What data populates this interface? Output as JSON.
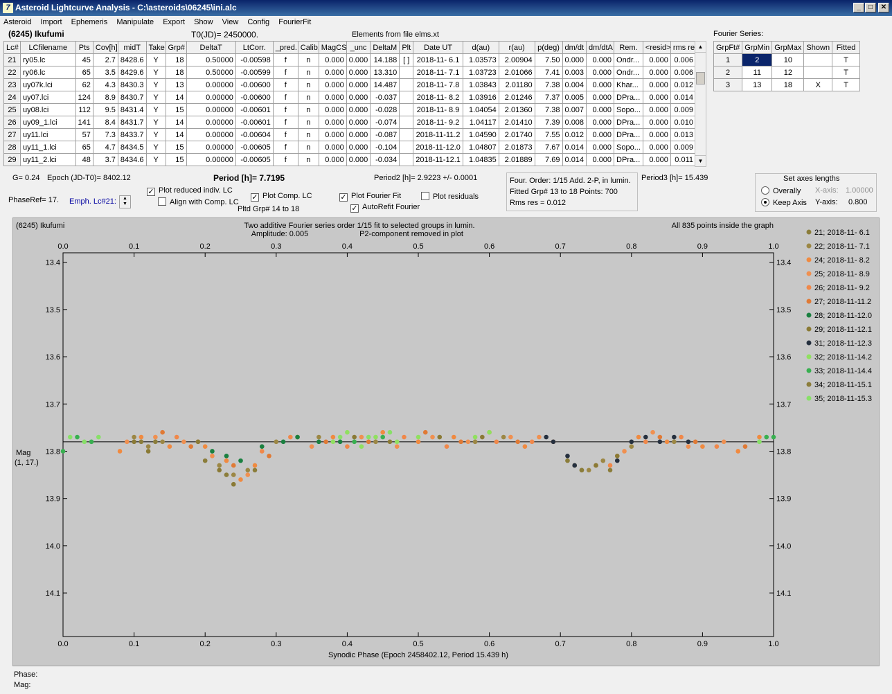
{
  "window": {
    "title": "Asteroid Lightcurve Analysis - C:\\asteroids\\06245\\ini.alc",
    "icon": "app-icon"
  },
  "menu": [
    "Asteroid",
    "Import",
    "Ephemeris",
    "Manipulate",
    "Export",
    "Show",
    "View",
    "Config",
    "FourierFit"
  ],
  "header": {
    "asteroid": "(6245) Ikufumi",
    "t0": "T0(JD)= 2450000.",
    "elements": "Elements from file elms.xt",
    "fourier_series_label": "Fourier Series:"
  },
  "lc_table": {
    "columns": [
      "Lc#",
      "LCfilename",
      "Pts",
      "Cov[h]",
      "midT",
      "Take",
      "Grp#",
      "DeltaT",
      "LtCorr.",
      "_pred.",
      "Calib.",
      "MagCS",
      "_unc",
      "DeltaM",
      "Plt",
      "Date UT",
      "d(au)",
      "r(au)",
      "p(deg)",
      "dm/dt",
      "dm/dtA",
      "Rem.",
      "<resid>",
      "rms res"
    ],
    "rows": [
      [
        "21",
        "ry05.lc",
        "45",
        "2.7",
        "8428.6",
        "Y",
        "18",
        "0.50000",
        "-0.00598",
        "f",
        "n",
        "0.000",
        "0.000",
        "14.188",
        "[ ]",
        "2018-11- 6.1",
        "1.03573",
        "2.00904",
        "7.50",
        "0.000",
        "0.000",
        "Ondr...",
        "0.000",
        "0.006"
      ],
      [
        "22",
        "ry06.lc",
        "65",
        "3.5",
        "8429.6",
        "Y",
        "18",
        "0.50000",
        "-0.00599",
        "f",
        "n",
        "0.000",
        "0.000",
        "13.310",
        "",
        "2018-11- 7.1",
        "1.03723",
        "2.01066",
        "7.41",
        "0.003",
        "0.000",
        "Ondr...",
        "0.000",
        "0.006"
      ],
      [
        "23",
        "uy07k.lci",
        "62",
        "4.3",
        "8430.3",
        "Y",
        "13",
        "0.00000",
        "-0.00600",
        "f",
        "n",
        "0.000",
        "0.000",
        "14.487",
        "",
        "2018-11- 7.8",
        "1.03843",
        "2.01180",
        "7.38",
        "0.004",
        "0.000",
        "Khar...",
        "0.000",
        "0.012"
      ],
      [
        "24",
        "uy07.lci",
        "124",
        "8.9",
        "8430.7",
        "Y",
        "14",
        "0.00000",
        "-0.00600",
        "f",
        "n",
        "0.000",
        "0.000",
        "-0.037",
        "",
        "2018-11- 8.2",
        "1.03916",
        "2.01246",
        "7.37",
        "0.005",
        "0.000",
        "DPra...",
        "0.000",
        "0.014"
      ],
      [
        "25",
        "uy08.lci",
        "112",
        "9.5",
        "8431.4",
        "Y",
        "15",
        "0.00000",
        "-0.00601",
        "f",
        "n",
        "0.000",
        "0.000",
        "-0.028",
        "",
        "2018-11- 8.9",
        "1.04054",
        "2.01360",
        "7.38",
        "0.007",
        "0.000",
        "Sopo...",
        "0.000",
        "0.009"
      ],
      [
        "26",
        "uy09_1.lci",
        "141",
        "8.4",
        "8431.7",
        "Y",
        "14",
        "0.00000",
        "-0.00601",
        "f",
        "n",
        "0.000",
        "0.000",
        "-0.074",
        "",
        "2018-11- 9.2",
        "1.04117",
        "2.01410",
        "7.39",
        "0.008",
        "0.000",
        "DPra...",
        "0.000",
        "0.010"
      ],
      [
        "27",
        "uy11.lci",
        "57",
        "7.3",
        "8433.7",
        "Y",
        "14",
        "0.00000",
        "-0.00604",
        "f",
        "n",
        "0.000",
        "0.000",
        "-0.087",
        "",
        "2018-11-11.2",
        "1.04590",
        "2.01740",
        "7.55",
        "0.012",
        "0.000",
        "DPra...",
        "0.000",
        "0.013"
      ],
      [
        "28",
        "uy11_1.lci",
        "65",
        "4.7",
        "8434.5",
        "Y",
        "15",
        "0.00000",
        "-0.00605",
        "f",
        "n",
        "0.000",
        "0.000",
        "-0.104",
        "",
        "2018-11-12.0",
        "1.04807",
        "2.01873",
        "7.67",
        "0.014",
        "0.000",
        "Sopo...",
        "0.000",
        "0.009"
      ],
      [
        "29",
        "uy11_2.lci",
        "48",
        "3.7",
        "8434.6",
        "Y",
        "15",
        "0.00000",
        "-0.00605",
        "f",
        "n",
        "0.000",
        "0.000",
        "-0.034",
        "",
        "2018-11-12.1",
        "1.04835",
        "2.01889",
        "7.69",
        "0.014",
        "0.000",
        "DPra...",
        "0.000",
        "0.011"
      ]
    ]
  },
  "fourier_table": {
    "columns": [
      "GrpFt#",
      "GrpMin",
      "GrpMax",
      "Shown",
      "Fitted"
    ],
    "rows": [
      [
        "1",
        "2",
        "10",
        "",
        "T"
      ],
      [
        "2",
        "11",
        "12",
        "",
        "T"
      ],
      [
        "3",
        "13",
        "18",
        "X",
        "T"
      ]
    ]
  },
  "controls": {
    "g": "G= 0.24",
    "epoch": "Epoch (JD-T0)= 8402.12",
    "period": "Period [h]= 7.7195",
    "period2": "Period2 [h]= 2.9223 +/- 0.0001",
    "phase_ref": "PhaseRef= 17.",
    "emph": "Emph. Lc#21:",
    "plot_reduced": "Plot reduced indiv. LC",
    "align_comp": "Align with Comp. LC",
    "plot_comp": "Plot Comp. LC",
    "pltd_grp": "Pltd Grp#  14 to   18",
    "plot_fourier": "Plot Fourier Fit",
    "autorefit": "AutoRefit Fourier",
    "plot_residuals": "Plot residuals",
    "plot_reduced_checked": true,
    "align_comp_checked": false,
    "plot_comp_checked": true,
    "plot_fourier_checked": true,
    "autorefit_checked": true,
    "plot_residuals_checked": false,
    "four_order": "Four. Order:  1/15    Add. 2-P, in lumin.",
    "fitted_grp": "Fitted Grp# 13 to 18 Points: 700",
    "rms_res": "Rms res     = 0.012",
    "period3": "Period3 [h]= 15.439",
    "axes": {
      "title": "Set axes lengths",
      "overally": "Overally",
      "keep_axis": "Keep Axis",
      "x_label": "X-axis:",
      "x_value": "1.00000",
      "y_label": "Y-axis:",
      "y_value": "0.800",
      "selected": "keep_axis"
    }
  },
  "footer": {
    "phase": "Phase:",
    "mag": "Mag:"
  },
  "chart_data": {
    "type": "scatter",
    "title": "Two additive Fourier series order 1/15 fit to selected groups in lumin.",
    "subtitle_left": "Amplitude: 0.005",
    "subtitle_right": "P2-component removed in plot",
    "top_left": "(6245) Ikufumi",
    "top_right": "All 835 points inside the graph",
    "xlabel": "Synodic Phase (Epoch 2458402.12, Period 15.439 h)",
    "ylabel": "Mag",
    "ylabel2": "(1, 17.)",
    "xlim": [
      0.0,
      1.0
    ],
    "ylim": [
      13.4,
      14.2
    ],
    "y_inverted": true,
    "xticks": [
      "0.0",
      "0.1",
      "0.2",
      "0.3",
      "0.4",
      "0.5",
      "0.6",
      "0.7",
      "0.8",
      "0.9",
      "1.0"
    ],
    "yticks": [
      "13.4",
      "13.5",
      "13.6",
      "13.7",
      "13.8",
      "13.9",
      "14.0",
      "14.1"
    ],
    "fit_level": 13.78,
    "series": [
      {
        "name": "21; 2018-11- 6.1",
        "color": "#8b7d3a",
        "points": []
      },
      {
        "name": "22; 2018-11- 7.1",
        "color": "#9c8744",
        "points": [
          [
            0.1,
            13.77
          ],
          [
            0.12,
            13.79
          ],
          [
            0.14,
            13.78
          ],
          [
            0.22,
            13.83
          ],
          [
            0.24,
            13.85
          ],
          [
            0.26,
            13.84
          ],
          [
            0.3,
            13.78
          ],
          [
            0.36,
            13.77
          ],
          [
            0.44,
            13.78
          ],
          [
            0.58,
            13.78
          ],
          [
            0.62,
            13.77
          ],
          [
            0.72,
            13.83
          ],
          [
            0.74,
            13.84
          ],
          [
            0.76,
            13.82
          ],
          [
            0.8,
            13.79
          ],
          [
            0.86,
            13.78
          ]
        ]
      },
      {
        "name": "24; 2018-11- 8.2",
        "color": "#f08a40",
        "points": [
          [
            0.08,
            13.8
          ],
          [
            0.11,
            13.77
          ],
          [
            0.15,
            13.79
          ],
          [
            0.2,
            13.79
          ],
          [
            0.23,
            13.82
          ],
          [
            0.25,
            13.86
          ],
          [
            0.27,
            13.83
          ],
          [
            0.33,
            13.77
          ],
          [
            0.38,
            13.77
          ],
          [
            0.45,
            13.76
          ],
          [
            0.5,
            13.78
          ],
          [
            0.55,
            13.77
          ],
          [
            0.6,
            13.76
          ],
          [
            0.65,
            13.79
          ],
          [
            0.69,
            13.78
          ],
          [
            0.78,
            13.81
          ],
          [
            0.81,
            13.77
          ],
          [
            0.85,
            13.78
          ],
          [
            0.9,
            13.79
          ],
          [
            0.95,
            13.8
          ],
          [
            0.98,
            13.77
          ]
        ]
      },
      {
        "name": "25; 2018-11- 8.9",
        "color": "#f09050",
        "points": [
          [
            0.09,
            13.78
          ],
          [
            0.13,
            13.77
          ],
          [
            0.17,
            13.78
          ],
          [
            0.21,
            13.81
          ],
          [
            0.26,
            13.85
          ],
          [
            0.35,
            13.79
          ],
          [
            0.42,
            13.77
          ],
          [
            0.47,
            13.79
          ],
          [
            0.52,
            13.77
          ],
          [
            0.57,
            13.78
          ],
          [
            0.63,
            13.77
          ],
          [
            0.67,
            13.77
          ],
          [
            0.79,
            13.8
          ],
          [
            0.83,
            13.76
          ],
          [
            0.88,
            13.79
          ],
          [
            0.93,
            13.78
          ]
        ]
      },
      {
        "name": "26; 2018-11- 9.2",
        "color": "#f0884a",
        "points": [
          [
            0.16,
            13.77
          ],
          [
            0.19,
            13.78
          ],
          [
            0.28,
            13.8
          ],
          [
            0.32,
            13.77
          ],
          [
            0.4,
            13.79
          ],
          [
            0.48,
            13.77
          ],
          [
            0.54,
            13.79
          ],
          [
            0.61,
            13.78
          ],
          [
            0.66,
            13.78
          ],
          [
            0.77,
            13.83
          ],
          [
            0.82,
            13.78
          ],
          [
            0.87,
            13.77
          ],
          [
            0.92,
            13.79
          ]
        ]
      },
      {
        "name": "27; 2018-11-11.2",
        "color": "#e07a35",
        "points": [
          [
            0.14,
            13.76
          ],
          [
            0.18,
            13.79
          ],
          [
            0.24,
            13.83
          ],
          [
            0.29,
            13.81
          ],
          [
            0.37,
            13.78
          ],
          [
            0.43,
            13.78
          ],
          [
            0.51,
            13.76
          ],
          [
            0.56,
            13.78
          ],
          [
            0.64,
            13.78
          ],
          [
            0.75,
            13.83
          ],
          [
            0.84,
            13.77
          ],
          [
            0.89,
            13.78
          ],
          [
            0.96,
            13.79
          ]
        ]
      },
      {
        "name": "28; 2018-11-12.0",
        "color": "#1a8040",
        "points": [
          [
            0.21,
            13.8
          ],
          [
            0.23,
            13.81
          ],
          [
            0.25,
            13.82
          ],
          [
            0.28,
            13.79
          ],
          [
            0.31,
            13.78
          ],
          [
            0.33,
            13.77
          ],
          [
            0.36,
            13.78
          ],
          [
            0.39,
            13.78
          ]
        ]
      },
      {
        "name": "29; 2018-11-12.1",
        "color": "#8a7a35",
        "points": [
          [
            0.1,
            13.78
          ],
          [
            0.12,
            13.8
          ],
          [
            0.19,
            13.78
          ],
          [
            0.22,
            13.84
          ],
          [
            0.24,
            13.87
          ],
          [
            0.41,
            13.77
          ],
          [
            0.46,
            13.78
          ],
          [
            0.53,
            13.77
          ],
          [
            0.59,
            13.77
          ],
          [
            0.73,
            13.84
          ],
          [
            0.75,
            13.83
          ],
          [
            0.78,
            13.81
          ]
        ]
      },
      {
        "name": "31; 2018-11-12.3",
        "color": "#25303f",
        "points": [
          [
            0.68,
            13.77
          ],
          [
            0.69,
            13.78
          ],
          [
            0.71,
            13.81
          ],
          [
            0.72,
            13.83
          ],
          [
            0.78,
            13.82
          ],
          [
            0.8,
            13.78
          ],
          [
            0.82,
            13.77
          ],
          [
            0.84,
            13.78
          ],
          [
            0.86,
            13.77
          ],
          [
            0.88,
            13.78
          ]
        ]
      },
      {
        "name": "32; 2018-11-14.2",
        "color": "#90e060",
        "points": [
          [
            0.38,
            13.78
          ],
          [
            0.4,
            13.76
          ],
          [
            0.42,
            13.79
          ],
          [
            0.44,
            13.77
          ],
          [
            0.47,
            13.78
          ],
          [
            0.5,
            13.77
          ],
          [
            0.58,
            13.77
          ],
          [
            0.6,
            13.76
          ]
        ]
      },
      {
        "name": "33; 2018-11-14.4",
        "color": "#38b050",
        "points": [
          [
            0.0,
            13.8
          ],
          [
            0.02,
            13.77
          ],
          [
            0.04,
            13.78
          ],
          [
            0.41,
            13.78
          ],
          [
            0.45,
            13.77
          ],
          [
            0.99,
            13.77
          ],
          [
            1.0,
            13.77
          ]
        ]
      },
      {
        "name": "34; 2018-11-15.1",
        "color": "#8b7d3a",
        "points": [
          [
            0.11,
            13.78
          ],
          [
            0.13,
            13.78
          ],
          [
            0.2,
            13.82
          ],
          [
            0.23,
            13.85
          ],
          [
            0.27,
            13.84
          ],
          [
            0.71,
            13.82
          ],
          [
            0.73,
            13.84
          ],
          [
            0.77,
            13.84
          ]
        ]
      },
      {
        "name": "35; 2018-11-15.3",
        "color": "#88e068",
        "points": [
          [
            0.01,
            13.77
          ],
          [
            0.03,
            13.78
          ],
          [
            0.05,
            13.77
          ],
          [
            0.39,
            13.77
          ],
          [
            0.43,
            13.77
          ],
          [
            0.46,
            13.76
          ],
          [
            0.98,
            13.78
          ]
        ]
      }
    ]
  }
}
